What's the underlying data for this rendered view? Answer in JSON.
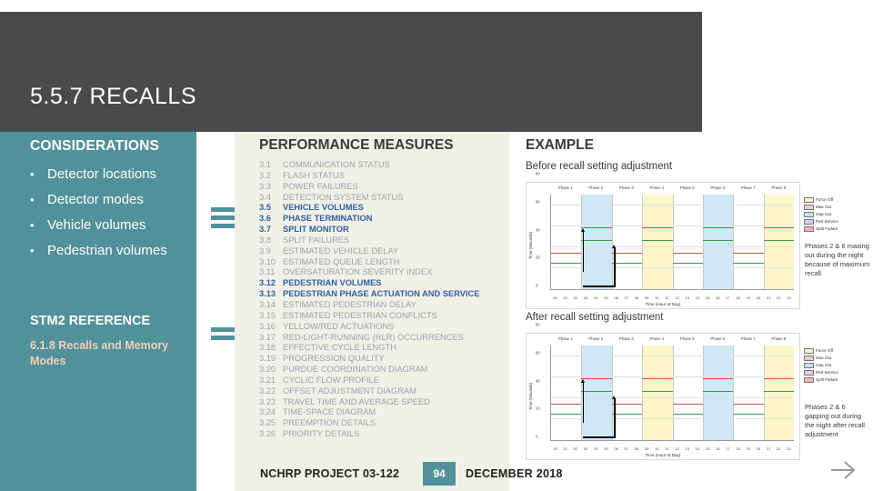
{
  "slide": {
    "title": "5.5.7 RECALLS"
  },
  "sidebar": {
    "heading": "CONSIDERATIONS",
    "bullet_marker": "•",
    "items": [
      "Detector locations",
      "Detector modes",
      "Vehicle volumes",
      "Pedestrian volumes"
    ],
    "reference_heading": "STM2 REFERENCE",
    "reference_text": "6.1.8 Recalls and Memory Modes",
    "bg_color": "#51919b",
    "reference_color": "#f2cfb6"
  },
  "performance": {
    "heading": "PERFORMANCE MEASURES",
    "highlight_color": "#2f5fa8",
    "muted_color": "#9aa3ad",
    "items": [
      {
        "num": "3.1",
        "text": "COMMUNICATION STATUS",
        "highlight": false
      },
      {
        "num": "3.2",
        "text": "FLASH STATUS",
        "highlight": false
      },
      {
        "num": "3.3",
        "text": "POWER FAILURES",
        "highlight": false
      },
      {
        "num": "3.4",
        "text": "DETECTION SYSTEM STATUS",
        "highlight": false
      },
      {
        "num": "3.5",
        "text": "VEHICLE VOLUMES",
        "highlight": true
      },
      {
        "num": "3.6",
        "text": "PHASE TERMINATION",
        "highlight": true
      },
      {
        "num": "3.7",
        "text": "SPLIT MONITOR",
        "highlight": true
      },
      {
        "num": "3.8",
        "text": "SPLIT FAILURES",
        "highlight": false
      },
      {
        "num": "3.9",
        "text": "ESTIMATED VEHICLE DELAY",
        "highlight": false
      },
      {
        "num": "3.10",
        "text": "ESTIMATED QUEUE LENGTH",
        "highlight": false
      },
      {
        "num": "3.11",
        "text": "OVERSATURATION SEVERITY INDEX",
        "highlight": false
      },
      {
        "num": "3.12",
        "text": "PEDESTRIAN VOLUMES",
        "highlight": true
      },
      {
        "num": "3.13",
        "text": "PEDESTRIAN PHASE ACTUATION AND SERVICE",
        "highlight": true
      },
      {
        "num": "3.14",
        "text": "ESTIMATED PEDESTRIAN DELAY",
        "highlight": false
      },
      {
        "num": "3.15",
        "text": "ESTIMATED PEDESTRIAN CONFLICTS",
        "highlight": false
      },
      {
        "num": "3.16",
        "text": "YELLOW/RED ACTUATIONS",
        "highlight": false
      },
      {
        "num": "3.17",
        "text": "RED-LIGHT-RUNNING (RLR) OCCURRENCES",
        "highlight": false
      },
      {
        "num": "3.18",
        "text": "EFFECTIVE CYCLE LENGTH",
        "highlight": false
      },
      {
        "num": "3.19",
        "text": "PROGRESSION QUALITY",
        "highlight": false
      },
      {
        "num": "3.20",
        "text": "PURDUE COORDINATION DIAGRAM",
        "highlight": false
      },
      {
        "num": "3.21",
        "text": "CYCLIC FLOW PROFILE",
        "highlight": false
      },
      {
        "num": "3.22",
        "text": "OFFSET ADJUSTMENT DIAGRAM",
        "highlight": false
      },
      {
        "num": "3.23",
        "text": "TRAVEL TIME AND AVERAGE SPEED",
        "highlight": false
      },
      {
        "num": "3.24",
        "text": "TIME-SPACE DIAGRAM",
        "highlight": false
      },
      {
        "num": "3.25",
        "text": "PREEMPTION DETAILS",
        "highlight": false
      },
      {
        "num": "3.26",
        "text": "PRIORITY DETAILS",
        "highlight": false
      }
    ]
  },
  "example": {
    "heading": "EXAMPLE",
    "caption_before": "Before recall setting adjustment",
    "caption_after": "After recall setting adjustment",
    "note_before": "Phases 2 & 6 maxing out during the night because of maximum recall",
    "note_after": "Phases 2 & 6 gapping out during the night after recall adjustment",
    "charts": [
      {
        "name": "before-split-monitor",
        "xlabel": "Time (Hour of Day)",
        "ylabel": "Time (Seconds)",
        "x_ticks": [
          "00",
          "01",
          "02",
          "03",
          "04",
          "05",
          "06",
          "07",
          "08",
          "09",
          "10",
          "11",
          "12",
          "13",
          "14",
          "15",
          "16",
          "17",
          "18",
          "19",
          "20",
          "21",
          "22",
          "23"
        ],
        "y_ticks": [
          "0",
          "20",
          "40",
          "60",
          "80"
        ],
        "column_headers": [
          "Phase 1",
          "Phase 2",
          "Phase 3",
          "Phase 4",
          "Phase 5",
          "Phase 6",
          "Phase 7",
          "Phase 8"
        ],
        "legend": [
          "Force Off",
          "Max Out",
          "Gap Out",
          "Ped Service",
          "Split Failure"
        ]
      },
      {
        "name": "after-split-monitor",
        "xlabel": "Time (Hour of Day)",
        "ylabel": "Time (Seconds)",
        "x_ticks": [
          "00",
          "01",
          "02",
          "03",
          "04",
          "05",
          "06",
          "07",
          "08",
          "09",
          "10",
          "11",
          "12",
          "13",
          "14",
          "15",
          "16",
          "17",
          "18",
          "19",
          "20",
          "21",
          "22",
          "23"
        ],
        "y_ticks": [
          "0",
          "20",
          "40",
          "60",
          "80"
        ],
        "column_headers": [
          "Phase 1",
          "Phase 2",
          "Phase 3",
          "Phase 4",
          "Phase 5",
          "Phase 6",
          "Phase 7",
          "Phase 8"
        ],
        "legend": [
          "Force Off",
          "Max Out",
          "Gap Out",
          "Ped Service",
          "Split Failure"
        ]
      }
    ]
  },
  "footer": {
    "project": "NCHRP PROJECT 03-122",
    "page": "94",
    "date": "DECEMBER 2018",
    "page_bg": "#51919b"
  }
}
